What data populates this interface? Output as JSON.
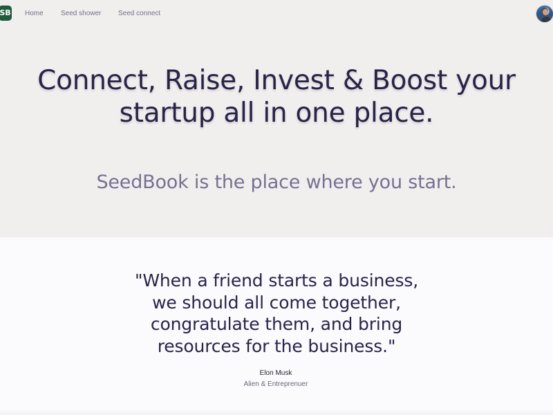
{
  "navbar": {
    "logo_text": "SB",
    "links": [
      {
        "label": "Home"
      },
      {
        "label": "Seed shower"
      },
      {
        "label": "Seed connect"
      }
    ],
    "avatar_icon": "profile-avatar-icon"
  },
  "hero": {
    "title": "Connect, Raise, Invest & Boost your startup all in one place.",
    "title_lines": [
      "Connect, Raise, Invest & Boost your",
      "startup all in one place."
    ],
    "subtitle": "SeedBook is the place where you start."
  },
  "quote": {
    "text_lines": [
      "\"When a friend starts a business,",
      "we should all come together,",
      "congratulate them, and bring",
      "resources for the business.\""
    ],
    "author": "Elon Musk",
    "role": "Alien & Entreprenuer"
  },
  "colors": {
    "logo_background": "#1f5a3b",
    "hero_background": "#f1eeee",
    "quote_background": "#fbfafc",
    "title_text": "#272447",
    "subtitle_text": "#777092",
    "nav_text": "#727284"
  }
}
